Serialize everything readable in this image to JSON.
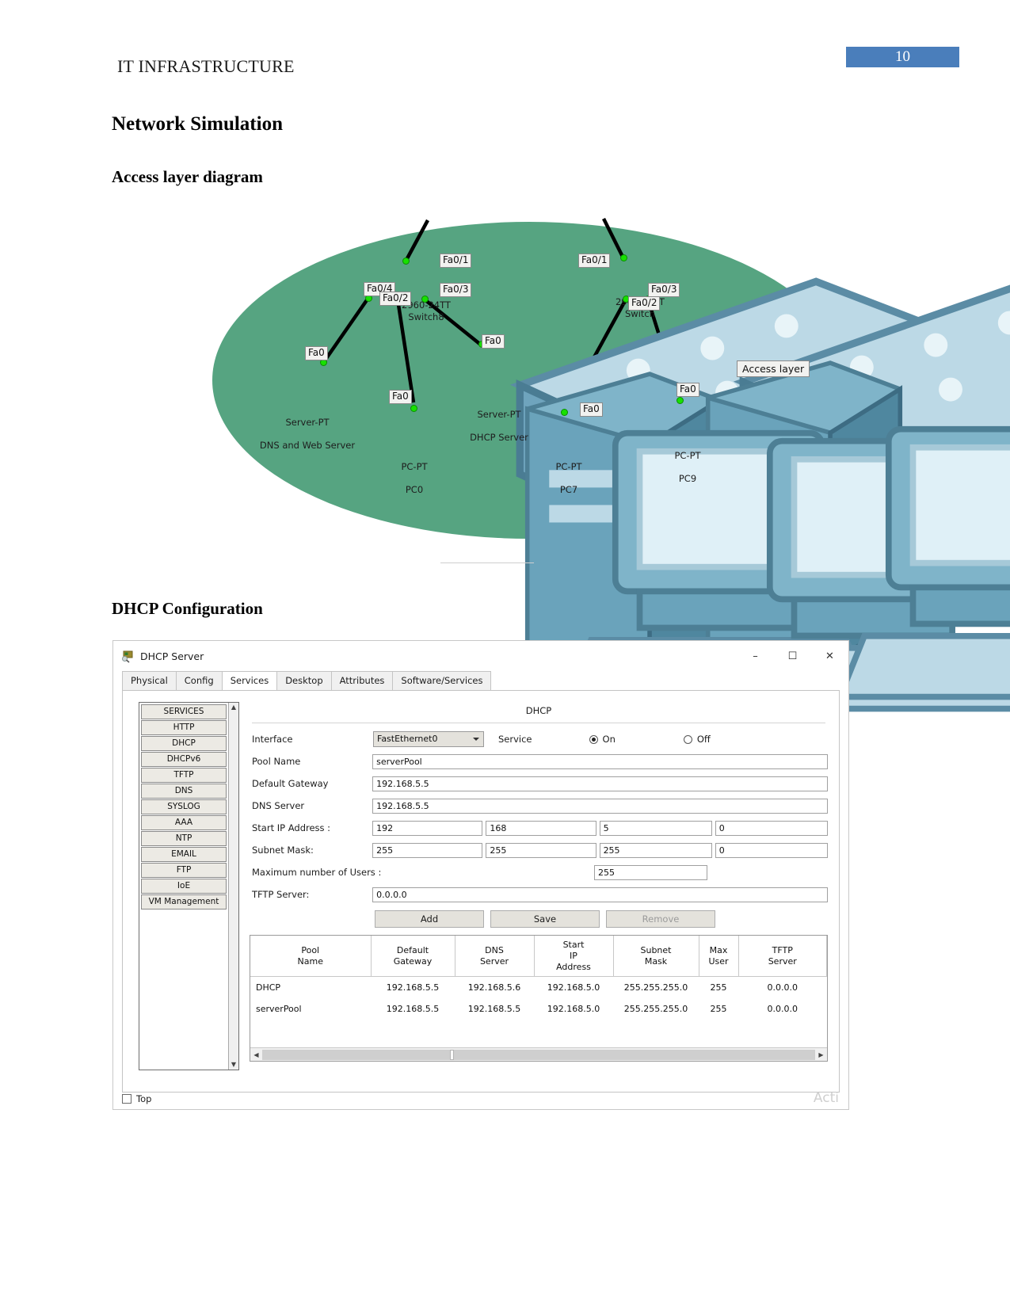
{
  "document": {
    "running_header": "IT INFRASTRUCTURE",
    "page_number": "10",
    "headings": {
      "network_simulation": "Network Simulation",
      "access_layer_diagram": "Access layer diagram",
      "dhcp_configuration": "DHCP Configuration"
    }
  },
  "diagram": {
    "zone_label": "Access layer",
    "zone_color": "#56a481",
    "switches": [
      {
        "id": "switch8",
        "name": "2960-24TT\nSwitch8",
        "ports": [
          "Fa0/1",
          "Fa0/4",
          "Fa0/2",
          "Fa0/3"
        ]
      },
      {
        "id": "switch_right",
        "name": "2960-24TT\nSwitch",
        "ports": [
          "Fa0/1",
          "Fa0/3",
          "Fa0/2"
        ]
      }
    ],
    "devices": [
      {
        "id": "dns-web-server",
        "type": "Server-PT",
        "name": "DNS and Web Server",
        "port": "Fa0"
      },
      {
        "id": "dhcp-server",
        "type": "Server-PT",
        "name": "DHCP Server",
        "port": "Fa0"
      },
      {
        "id": "pc0",
        "type": "PC-PT",
        "name": "PC0",
        "port": "Fa0"
      },
      {
        "id": "pc7",
        "type": "PC-PT",
        "name": "PC7",
        "port": "Fa0"
      },
      {
        "id": "pc9",
        "type": "PC-PT",
        "name": "PC9",
        "port": "Fa0"
      }
    ]
  },
  "dhcp_window": {
    "title": "DHCP Server",
    "title_icon": "server-icon",
    "controls": {
      "minimize": "–",
      "maximize": "☐",
      "close": "✕"
    },
    "tabs": [
      {
        "label": "Physical",
        "active": false
      },
      {
        "label": "Config",
        "active": false
      },
      {
        "label": "Services",
        "active": true
      },
      {
        "label": "Desktop",
        "active": false
      },
      {
        "label": "Attributes",
        "active": false
      },
      {
        "label": "Software/Services",
        "active": false
      }
    ],
    "services_list": [
      "SERVICES",
      "HTTP",
      "DHCP",
      "DHCPv6",
      "TFTP",
      "DNS",
      "SYSLOG",
      "AAA",
      "NTP",
      "EMAIL",
      "FTP",
      "IoE",
      "VM Management"
    ],
    "panel_title": "DHCP",
    "fields": {
      "interface_label": "Interface",
      "interface_value": "FastEthernet0",
      "service_label": "Service",
      "service_on": "On",
      "service_off": "Off",
      "service_state": "on",
      "pool_name_label": "Pool Name",
      "pool_name_value": "serverPool",
      "default_gateway_label": "Default Gateway",
      "default_gateway_value": "192.168.5.5",
      "dns_server_label": "DNS Server",
      "dns_server_value": "192.168.5.5",
      "start_ip_label": "Start IP Address :",
      "start_ip_octets": [
        "192",
        "168",
        "5",
        "0"
      ],
      "subnet_mask_label": "Subnet Mask:",
      "subnet_mask_octets": [
        "255",
        "255",
        "255",
        "0"
      ],
      "max_users_label": "Maximum number of Users :",
      "max_users_value": "255",
      "tftp_server_label": "TFTP Server:",
      "tftp_server_value": "0.0.0.0"
    },
    "buttons": {
      "add": "Add",
      "save": "Save",
      "remove": "Remove"
    },
    "table": {
      "headers": [
        "Pool\nName",
        "Default\nGateway",
        "DNS\nServer",
        "Start\nIP\nAddress",
        "Subnet\nMask",
        "Max\nUser",
        "TFTP\nServer"
      ],
      "rows": [
        [
          "DHCP",
          "192.168.5.5",
          "192.168.5.6",
          "192.168.5.0",
          "255.255.255.0",
          "255",
          "0.0.0.0"
        ],
        [
          "serverPool",
          "192.168.5.5",
          "192.168.5.5",
          "192.168.5.0",
          "255.255.255.0",
          "255",
          "0.0.0.0"
        ]
      ]
    },
    "footer": {
      "top_checkbox_label": "Top",
      "top_checked": false
    },
    "watermark": "Acti"
  }
}
